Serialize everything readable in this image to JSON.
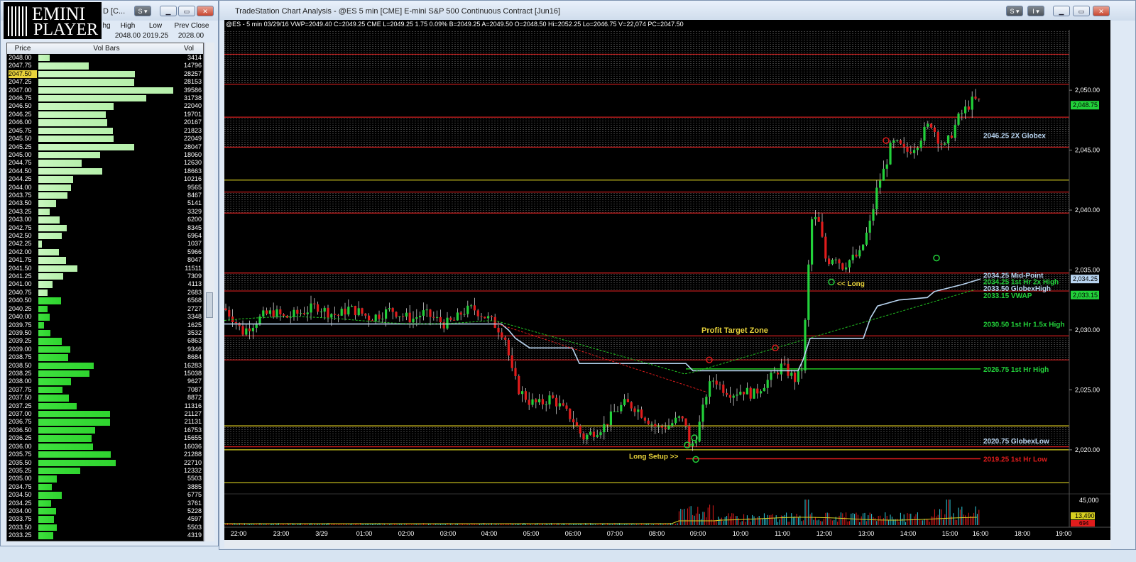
{
  "logo": {
    "line1": "EMINI",
    "line2": "PLAYER"
  },
  "left_window": {
    "title": "D [C...",
    "quote_headers": [
      "hg",
      "High",
      "Low",
      "Prev Close"
    ],
    "quote_values": [
      "2048.00",
      "2019.25",
      "2028.00"
    ],
    "ladder_headers": {
      "price": "Price",
      "bars": "Vol Bars",
      "vol": "Vol"
    },
    "selected_price": "2047.50",
    "rows": [
      [
        "2048.00",
        3414
      ],
      [
        "2047.75",
        14796
      ],
      [
        "2047.50",
        28257
      ],
      [
        "2047.25",
        28153
      ],
      [
        "2047.00",
        39586
      ],
      [
        "2046.75",
        31738
      ],
      [
        "2046.50",
        22040
      ],
      [
        "2046.25",
        19701
      ],
      [
        "2046.00",
        20167
      ],
      [
        "2045.75",
        21823
      ],
      [
        "2045.50",
        22049
      ],
      [
        "2045.25",
        28047
      ],
      [
        "2045.00",
        18060
      ],
      [
        "2044.75",
        12630
      ],
      [
        "2044.50",
        18663
      ],
      [
        "2044.25",
        10216
      ],
      [
        "2044.00",
        9565
      ],
      [
        "2043.75",
        8467
      ],
      [
        "2043.50",
        5141
      ],
      [
        "2043.25",
        3329
      ],
      [
        "2043.00",
        6200
      ],
      [
        "2042.75",
        8345
      ],
      [
        "2042.50",
        6964
      ],
      [
        "2042.25",
        1037
      ],
      [
        "2042.00",
        5966
      ],
      [
        "2041.75",
        8047
      ],
      [
        "2041.50",
        11511
      ],
      [
        "2041.25",
        7309
      ],
      [
        "2041.00",
        4113
      ],
      [
        "2040.75",
        2683
      ],
      [
        "2040.50",
        6568
      ],
      [
        "2040.25",
        2727
      ],
      [
        "2040.00",
        3348
      ],
      [
        "2039.75",
        1625
      ],
      [
        "2039.50",
        3532
      ],
      [
        "2039.25",
        6863
      ],
      [
        "2039.00",
        9346
      ],
      [
        "2038.75",
        8684
      ],
      [
        "2038.50",
        16283
      ],
      [
        "2038.25",
        15038
      ],
      [
        "2038.00",
        9627
      ],
      [
        "2037.75",
        7087
      ],
      [
        "2037.50",
        8872
      ],
      [
        "2037.25",
        11316
      ],
      [
        "2037.00",
        21127
      ],
      [
        "2036.75",
        21131
      ],
      [
        "2036.50",
        16753
      ],
      [
        "2036.25",
        15655
      ],
      [
        "2036.00",
        16036
      ],
      [
        "2035.75",
        21288
      ],
      [
        "2035.50",
        22710
      ],
      [
        "2035.25",
        12332
      ],
      [
        "2035.00",
        5503
      ],
      [
        "2034.75",
        3885
      ],
      [
        "2034.50",
        6775
      ],
      [
        "2034.25",
        3761
      ],
      [
        "2034.00",
        5228
      ],
      [
        "2033.75",
        4597
      ],
      [
        "2033.50",
        5503
      ],
      [
        "2033.25",
        4319
      ]
    ]
  },
  "chart_window": {
    "title": "TradeStation Chart Analysis - @ES 5 min [CME] E-mini S&P 500 Continuous Contract [Jun16]",
    "status_line": "@ES - 5 min  03/29/16  VWP=2049.40  C=2049.25  CME  L=2049.25  1.75  0.09%  B=2049.25  A=2049.50  O=2048.50  Hi=2052.25  Lo=2046.75  V=22,074  PC=2047.50",
    "colors": {
      "bg": "#000000",
      "up": "#22d13a",
      "down": "#e01c1c",
      "vwap_line": "#b8d4f0",
      "zone_line": "#d42020",
      "yellow_line": "#d8d020",
      "green_level": "#22c422"
    }
  },
  "chart_data": {
    "type": "candlestick",
    "y_ticks": [
      "2,050.00",
      "2,045.00",
      "2,040.00",
      "2,035.00",
      "2,030.00",
      "2,025.00",
      "2,020.00"
    ],
    "ylim": [
      2016.5,
      2053.5
    ],
    "x_ticks": [
      "22:00",
      "23:00",
      "3/29",
      "01:00",
      "02:00",
      "03:00",
      "04:00",
      "05:00",
      "06:00",
      "07:00",
      "08:00",
      "09:00",
      "10:00",
      "11:00",
      "12:00",
      "13:00",
      "14:00",
      "15:00",
      "16:00",
      "18:00",
      "19:00"
    ],
    "last_price_tag": "2,048.75",
    "price_tags": [
      "2,034.25",
      "2,033.15"
    ],
    "zones": [
      [
        2050.5,
        2053.0
      ],
      [
        2045.25,
        2047.75
      ],
      [
        2039.75,
        2041.5
      ],
      [
        2033.25,
        2034.75
      ],
      [
        2027.5,
        2029.5
      ],
      [
        2020.25,
        2022.0
      ]
    ],
    "yellow_levels": [
      2042.5,
      2022.0,
      2020.0,
      2017.25
    ],
    "level_labels": [
      {
        "text": "2046.25 2X Globex",
        "price": 2046.25,
        "color": "#b8d4f0"
      },
      {
        "text": "2034.25 Mid-Point",
        "price": 2034.6,
        "color": "#b8d4f0"
      },
      {
        "text": "2034.25 1st Hr  2x High",
        "price": 2034.05,
        "color": "#22d13a"
      },
      {
        "text": "2033.50 GlobexHigh",
        "price": 2033.5,
        "color": "#b8d4f0"
      },
      {
        "text": "2033.15 VWAP",
        "price": 2032.9,
        "color": "#22d13a"
      },
      {
        "text": "2030.50 1st Hr  1.5x High",
        "price": 2030.5,
        "color": "#22d13a"
      },
      {
        "text": "2026.75 1st Hr  High",
        "price": 2026.75,
        "color": "#22d13a"
      },
      {
        "text": "2020.75 GlobexLow",
        "price": 2020.75,
        "color": "#b8d4f0"
      },
      {
        "text": "2019.25 1st Hr  Low",
        "price": 2019.25,
        "color": "#e01c1c"
      }
    ],
    "annotations": [
      {
        "text": "Profit Target Zone",
        "price": 2030.0,
        "x_time": "10:00"
      },
      {
        "text": "<< Long",
        "price": 2033.9,
        "x_time": "12:00"
      },
      {
        "text": "Long Setup >>",
        "price": 2019.5,
        "x_time": "08:00"
      }
    ],
    "path_points": [
      [
        0,
        2031.8
      ],
      [
        15,
        2030.8
      ],
      [
        25,
        2029.8
      ],
      [
        40,
        2030.5
      ],
      [
        55,
        2031.2
      ],
      [
        70,
        2031.5
      ],
      [
        85,
        2031.0
      ],
      [
        100,
        2031.3
      ],
      [
        115,
        2031.6
      ],
      [
        130,
        2032.0
      ],
      [
        145,
        2031.5
      ],
      [
        160,
        2031.2
      ],
      [
        175,
        2031.8
      ],
      [
        190,
        2031.5
      ],
      [
        205,
        2031.0
      ],
      [
        220,
        2031.3
      ],
      [
        235,
        2031.7
      ],
      [
        250,
        2031.2
      ],
      [
        265,
        2030.9
      ],
      [
        280,
        2031.4
      ],
      [
        295,
        2031.0
      ],
      [
        310,
        2030.5
      ],
      [
        325,
        2030.8
      ],
      [
        335,
        2031.5
      ],
      [
        350,
        2031.8
      ],
      [
        365,
        2031.2
      ],
      [
        375,
        2030.8
      ],
      [
        385,
        2030.2
      ],
      [
        395,
        2029.5
      ],
      [
        405,
        2026.5
      ],
      [
        415,
        2025.0
      ],
      [
        430,
        2024.0
      ],
      [
        445,
        2023.8
      ],
      [
        460,
        2024.4
      ],
      [
        475,
        2023.5
      ],
      [
        490,
        2022.6
      ],
      [
        505,
        2021.0
      ],
      [
        520,
        2021.5
      ],
      [
        535,
        2022.0
      ],
      [
        550,
        2023.2
      ],
      [
        565,
        2023.9
      ],
      [
        580,
        2023.5
      ],
      [
        595,
        2022.6
      ],
      [
        610,
        2021.8
      ],
      [
        625,
        2022.0
      ],
      [
        640,
        2022.6
      ],
      [
        650,
        2022.2
      ],
      [
        655,
        2020.0
      ],
      [
        665,
        2021.2
      ],
      [
        672,
        2022.8
      ],
      [
        680,
        2025.0
      ],
      [
        690,
        2026.0
      ],
      [
        700,
        2025.2
      ],
      [
        715,
        2024.7
      ],
      [
        730,
        2025.0
      ],
      [
        745,
        2024.6
      ],
      [
        760,
        2025.5
      ],
      [
        775,
        2026.3
      ],
      [
        785,
        2027.0
      ],
      [
        795,
        2026.4
      ],
      [
        805,
        2025.8
      ],
      [
        815,
        2027.0
      ],
      [
        820,
        2033.0
      ],
      [
        828,
        2039.5
      ],
      [
        838,
        2038.8
      ],
      [
        848,
        2035.6
      ],
      [
        860,
        2036.3
      ],
      [
        870,
        2035.3
      ],
      [
        880,
        2035.8
      ],
      [
        895,
        2036.3
      ],
      [
        910,
        2039.0
      ],
      [
        920,
        2042.0
      ],
      [
        930,
        2043.5
      ],
      [
        940,
        2045.6
      ],
      [
        950,
        2045.4
      ],
      [
        960,
        2044.8
      ],
      [
        975,
        2045.5
      ],
      [
        985,
        2046.5
      ],
      [
        995,
        2047.3
      ],
      [
        1005,
        2046.0
      ],
      [
        1015,
        2045.2
      ],
      [
        1025,
        2046.5
      ],
      [
        1035,
        2047.8
      ],
      [
        1045,
        2048.5
      ],
      [
        1055,
        2049.2
      ],
      [
        1065,
        2049.0
      ]
    ],
    "vwap_points": [
      [
        0,
        2030.5
      ],
      [
        390,
        2030.5
      ],
      [
        400,
        2030.0
      ],
      [
        410,
        2029.3
      ],
      [
        430,
        2028.5
      ],
      [
        490,
        2028.5
      ],
      [
        500,
        2027.2
      ],
      [
        650,
        2027.2
      ],
      [
        660,
        2026.6
      ],
      [
        808,
        2026.6
      ],
      [
        815,
        2027.5
      ],
      [
        825,
        2029.3
      ],
      [
        900,
        2029.3
      ],
      [
        910,
        2031.0
      ],
      [
        920,
        2032.0
      ],
      [
        950,
        2032.5
      ],
      [
        990,
        2032.7
      ],
      [
        1000,
        2033.2
      ],
      [
        1040,
        2033.8
      ],
      [
        1065,
        2034.25
      ]
    ]
  }
}
